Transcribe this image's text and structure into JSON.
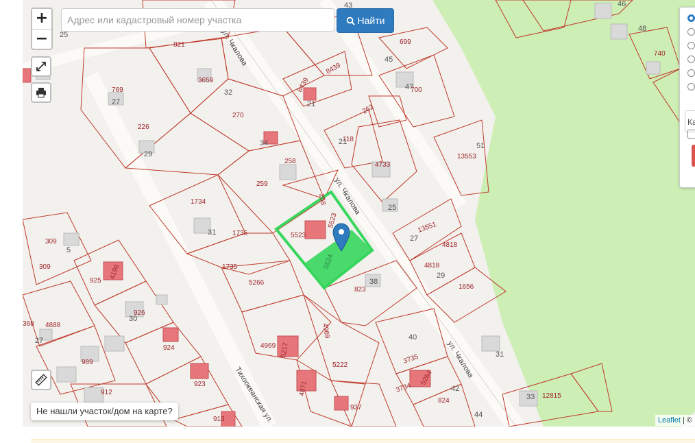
{
  "search": {
    "placeholder": "Адрес или кадастровый номер участка"
  },
  "find_button": {
    "label": "Найти"
  },
  "zoom": {
    "in": "+",
    "out": "−"
  },
  "not_found_button": {
    "label": "Не нашли участок/дом на карте?"
  },
  "attribution": {
    "leaflet": "Leaflet",
    "rest": " | ©"
  },
  "side_panel": {
    "input_text": "Ка"
  },
  "colors": {
    "parcel_line": "#c0392b",
    "selected_parcel": "#37d65d",
    "marker": "#2e7bbf",
    "forest": "#cdeeb5"
  },
  "streets": [
    "ул. Чкалова",
    "ул. Чкалова",
    "ул. Чкалова",
    "Тихоокеанская ул."
  ],
  "parcel_labels": [
    "821",
    "769",
    "226",
    "270",
    "3659",
    "259",
    "258",
    "1734",
    "1735",
    "1735",
    "5266",
    "5523",
    "5523",
    "258",
    "5524",
    "823",
    "4969",
    "4969",
    "5222",
    "4733",
    "118",
    "262",
    "8439",
    "8439",
    "13553",
    "13551",
    "4818",
    "4818",
    "1656",
    "3735",
    "3734",
    "5264",
    "824",
    "12815",
    "309",
    "309",
    "925",
    "926",
    "924",
    "4888",
    "368",
    "989",
    "912",
    "923",
    "937",
    "913",
    "699",
    "700",
    "740",
    "4198",
    "5217",
    "4871"
  ],
  "house_numbers": [
    "25",
    "27",
    "29",
    "32",
    "34",
    "21",
    "21",
    "45",
    "47",
    "51",
    "46",
    "48",
    "25",
    "27",
    "29",
    "38",
    "31",
    "40",
    "42",
    "44",
    "33",
    "5",
    "30",
    "27",
    "43",
    "31"
  ]
}
